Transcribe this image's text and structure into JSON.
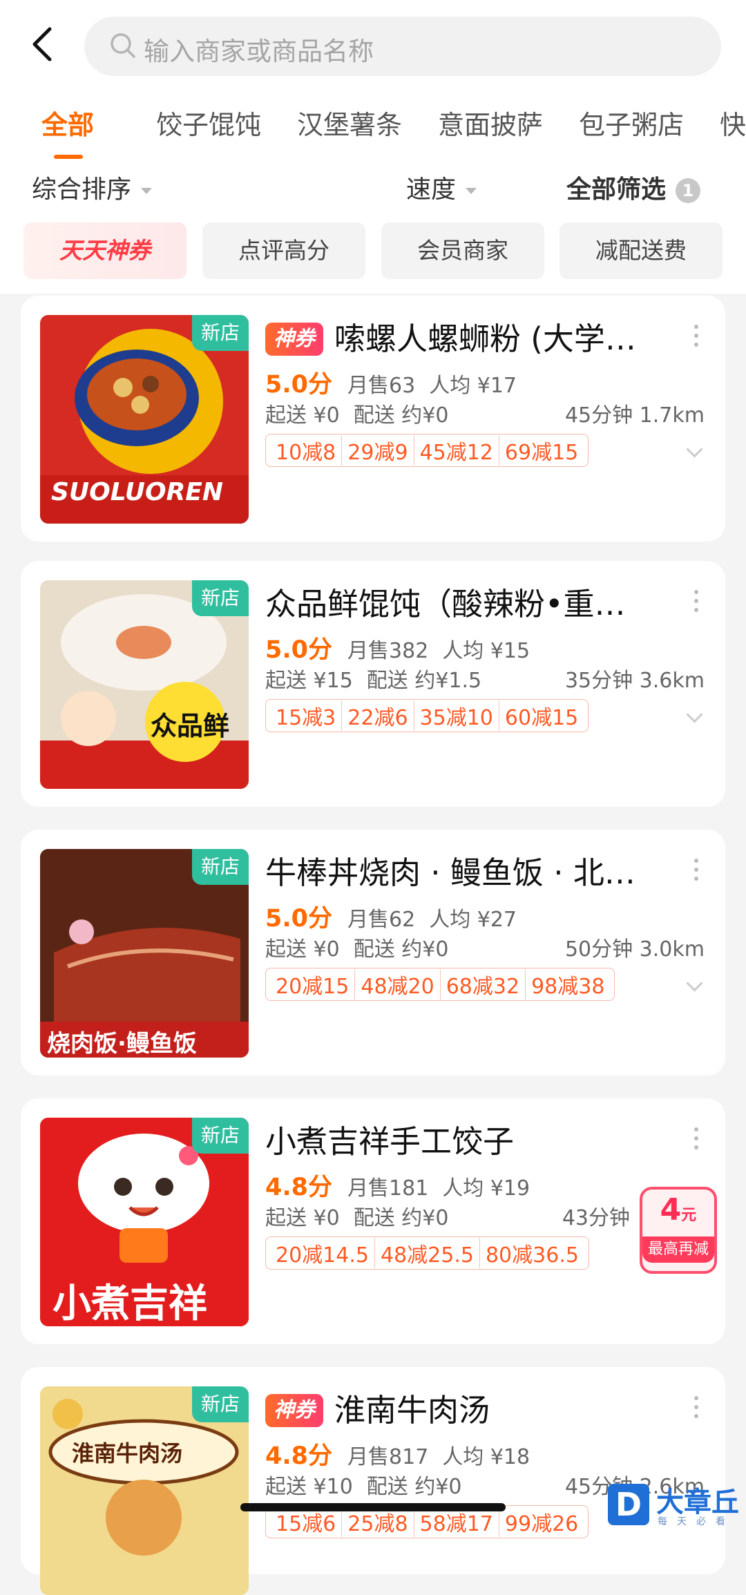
{
  "search": {
    "placeholder": "输入商家或商品名称"
  },
  "tabs": [
    {
      "label": "全部",
      "active": true
    },
    {
      "label": "饺子馄饨"
    },
    {
      "label": "汉堡薯条"
    },
    {
      "label": "意面披萨"
    },
    {
      "label": "包子粥店"
    },
    {
      "label": "快"
    }
  ],
  "sortbar": {
    "overall": "综合排序",
    "speed": "速度",
    "filter": "全部筛选",
    "filter_count": "1"
  },
  "chips": [
    "天天神券",
    "点评高分",
    "会员商家",
    "减配送费"
  ],
  "labels": {
    "new_store": "新店",
    "shenquan": "神券"
  },
  "stores": [
    {
      "name": "嗦螺人螺蛳粉 (大学…",
      "has_coupon": true,
      "score": "5.0分",
      "monthly": "月售63",
      "avg": "人均 ¥17",
      "min_order": "起送 ¥0",
      "delivery_fee": "配送 约¥0",
      "distance": "45分钟 1.7km",
      "promos": [
        "10减8",
        "29减9",
        "45减12",
        "69减15"
      ],
      "image_text": "SUOLUOREN"
    },
    {
      "name": "众品鲜馄饨（酸辣粉•重…",
      "has_coupon": false,
      "score": "5.0分",
      "monthly": "月售382",
      "avg": "人均 ¥15",
      "min_order": "起送 ¥15",
      "delivery_fee": "配送 约¥1.5",
      "distance": "35分钟 3.6km",
      "promos": [
        "15减3",
        "22减6",
        "35减10",
        "60减15"
      ],
      "image_text": "众品鲜"
    },
    {
      "name": "牛棒丼烧肉 · 鳗鱼饭 · 北…",
      "has_coupon": false,
      "score": "5.0分",
      "monthly": "月售62",
      "avg": "人均 ¥27",
      "min_order": "起送 ¥0",
      "delivery_fee": "配送 约¥0",
      "distance": "50分钟 3.0km",
      "promos": [
        "20减15",
        "48减20",
        "68减32",
        "98减38"
      ],
      "image_text": "烧肉饭·鳗鱼饭"
    },
    {
      "name": "小煮吉祥手工饺子",
      "has_coupon": false,
      "score": "4.8分",
      "monthly": "月售181",
      "avg": "人均 ¥19",
      "min_order": "起送 ¥0",
      "delivery_fee": "配送 约¥0",
      "distance": "43分钟",
      "promos": [
        "20减14.5",
        "48减25.5",
        "80减36.5"
      ],
      "image_text": "小煮吉祥",
      "float_badge": {
        "amount": "4",
        "unit": "元",
        "label": "最高再减"
      }
    },
    {
      "name": "淮南牛肉汤",
      "has_coupon": true,
      "score": "4.8分",
      "monthly": "月售817",
      "avg": "人均 ¥18",
      "min_order": "起送 ¥10",
      "delivery_fee": "配送 约¥0",
      "distance": "45分钟 2.6km",
      "promos": [
        "15减6",
        "25减8",
        "58减17",
        "99减26"
      ],
      "image_text": "淮南牛肉汤"
    }
  ],
  "watermark": {
    "logo": "D",
    "text": "大章丘",
    "sub": "每天必看"
  },
  "colors": {
    "accent": "#ff6a00",
    "new_tag": "#2fbf9f",
    "promo": "#ff5a24"
  }
}
